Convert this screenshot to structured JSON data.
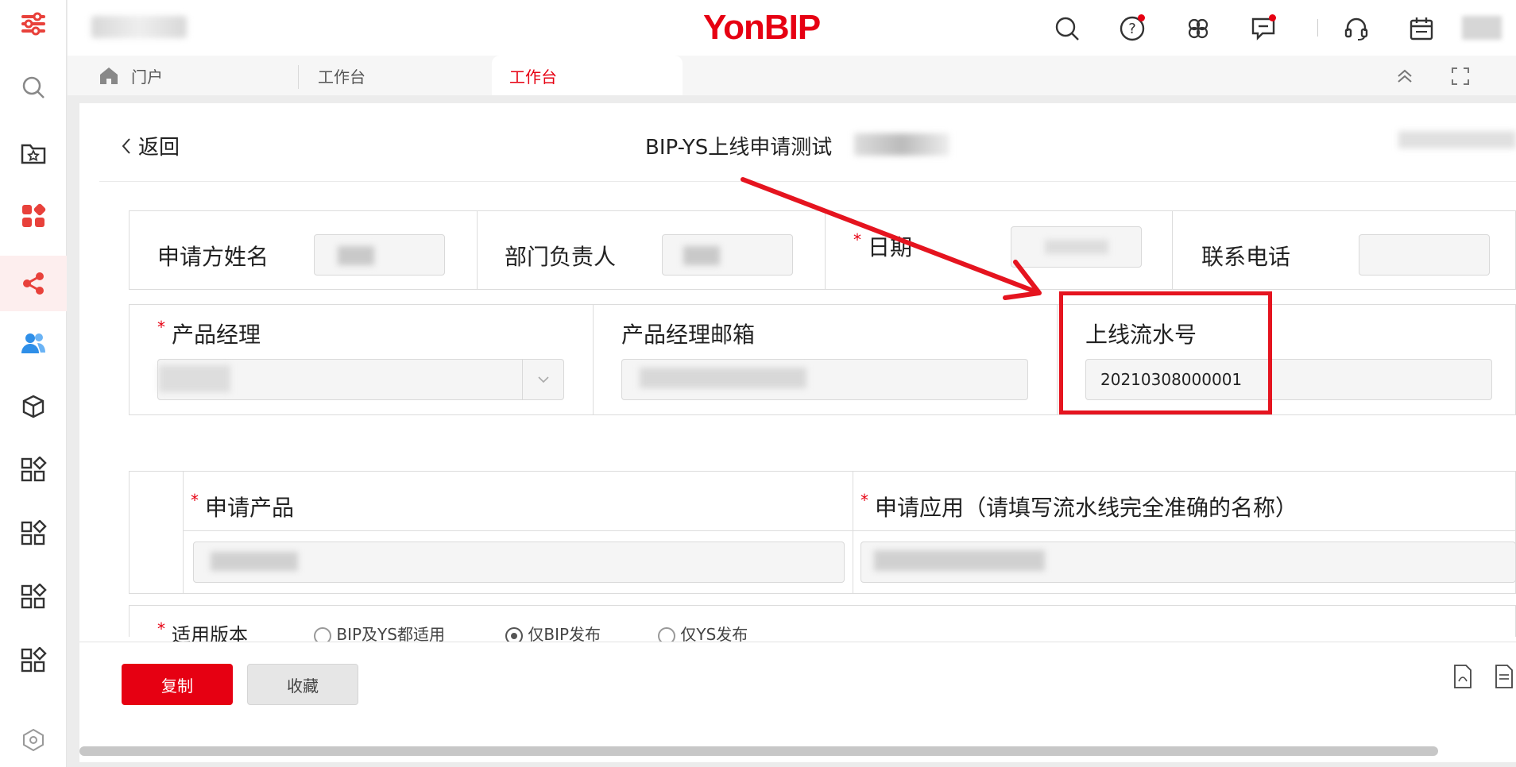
{
  "app": {
    "logo": "YonBIP"
  },
  "tabs": [
    {
      "label": "门户"
    },
    {
      "label": "工作台"
    },
    {
      "label": "工作台"
    }
  ],
  "header": {
    "back_label": "返回",
    "title": "BIP-YS上线申请测试"
  },
  "form": {
    "row1": [
      {
        "label": "申请方姓名",
        "required": false
      },
      {
        "label": "部门负责人",
        "required": false
      },
      {
        "label": "日期",
        "required": true
      },
      {
        "label": "联系电话",
        "required": false
      }
    ],
    "row2": {
      "product_manager": {
        "label": "产品经理",
        "required": true
      },
      "pm_email": {
        "label": "产品经理邮箱",
        "required": false
      },
      "serial": {
        "label": "上线流水号",
        "value": "20210308000001"
      }
    },
    "row3": {
      "product": {
        "label": "申请产品",
        "required": true
      },
      "application": {
        "label": "申请应用（请填写流水线完全准确的名称）",
        "required": true
      }
    },
    "version": {
      "label": "适用版本",
      "options": [
        "BIP及YS都适用",
        "仅BIP发布",
        "仅YS发布"
      ],
      "selected": "仅BIP发布"
    }
  },
  "footer": {
    "copy_label": "复制",
    "favorite_label": "收藏"
  },
  "annotation": {
    "color": "#e5141f"
  }
}
